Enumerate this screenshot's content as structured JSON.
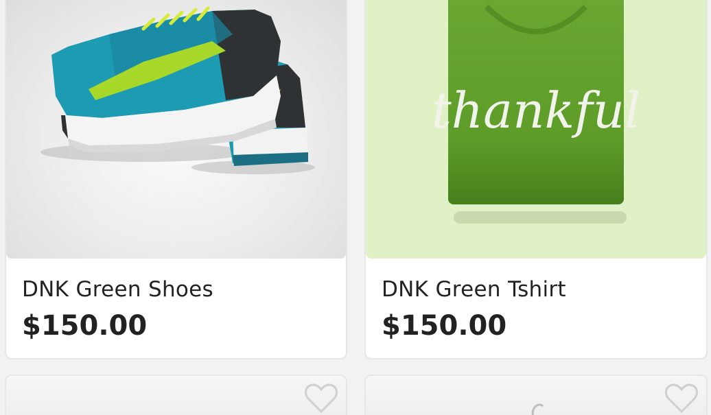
{
  "products": [
    {
      "name": "DNK Green Shoes",
      "price": "$150.00",
      "image": "shoes-image"
    },
    {
      "name": "DNK Green Tshirt",
      "price": "$150.00",
      "image": "tshirt-image",
      "tshirt_print": "thankful"
    },
    {
      "image": "placeholder-image"
    },
    {
      "image": "hanger-image"
    }
  ],
  "icons": {
    "favorite": "heart-outline-icon"
  },
  "colors": {
    "card_bg": "#ffffff",
    "card_border": "#e6e6e6",
    "text": "#222222",
    "shirt_bg": "#e1f1c6",
    "shirt": "#5f9f2a"
  }
}
